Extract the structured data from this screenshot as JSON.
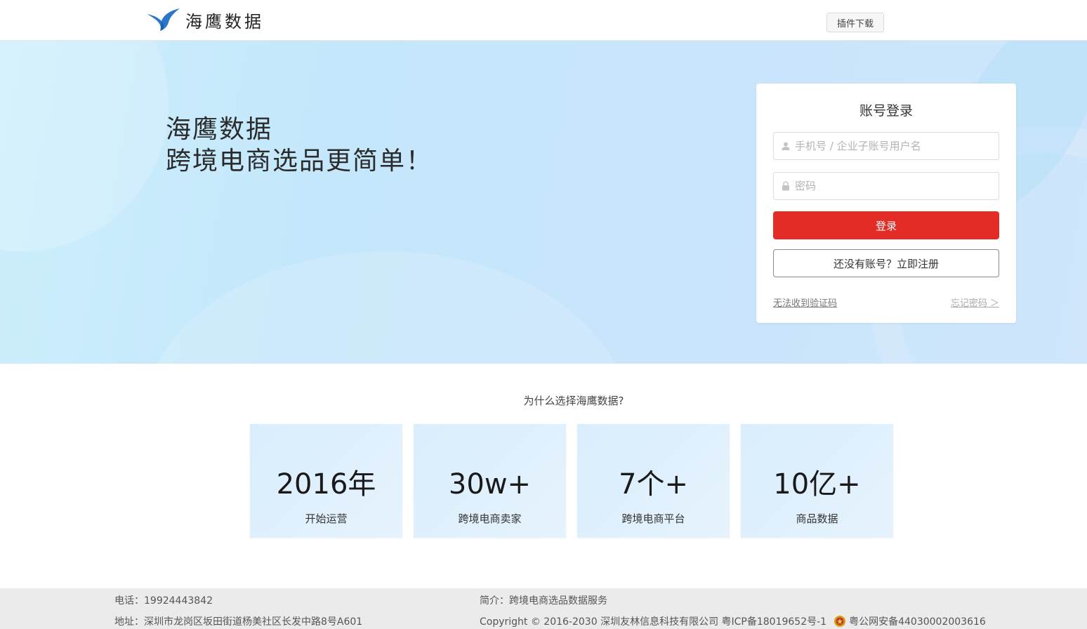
{
  "header": {
    "brand": "海鹰数据",
    "plugin_download": "插件下载"
  },
  "hero": {
    "line1": "海鹰数据",
    "line2": "跨境电商选品更简单！"
  },
  "login": {
    "title": "账号登录",
    "username_placeholder": "手机号 / 企业子账号用户名",
    "password_placeholder": "密码",
    "login_button": "登录",
    "register_button": "还没有账号？立即注册",
    "no_code_link": "无法收到验证码",
    "forgot_link": "忘记密码 ＞"
  },
  "why": {
    "title": "为什么选择海鹰数据?",
    "stats": [
      {
        "value": "2016年",
        "label": "开始运营"
      },
      {
        "value": "30w+",
        "label": "跨境电商卖家"
      },
      {
        "value": "7个+",
        "label": "跨境电商平台"
      },
      {
        "value": "10亿+",
        "label": "商品数据"
      }
    ]
  },
  "footer": {
    "phone": "电话：19924443842",
    "address": "地址：深圳市龙岗区坂田街道杨美社区长发中路8号A601",
    "intro": "简介：跨境电商选品数据服务",
    "copyright": "Copyright © 2016-2030 深圳友林信息科技有限公司  粤ICP备18019652号-1",
    "police": "粤公网安备44030002003616"
  },
  "colors": {
    "primary_red": "#e32c25",
    "hero_bg": "#c8e7fb",
    "brand_blue": "#2a77c9"
  }
}
